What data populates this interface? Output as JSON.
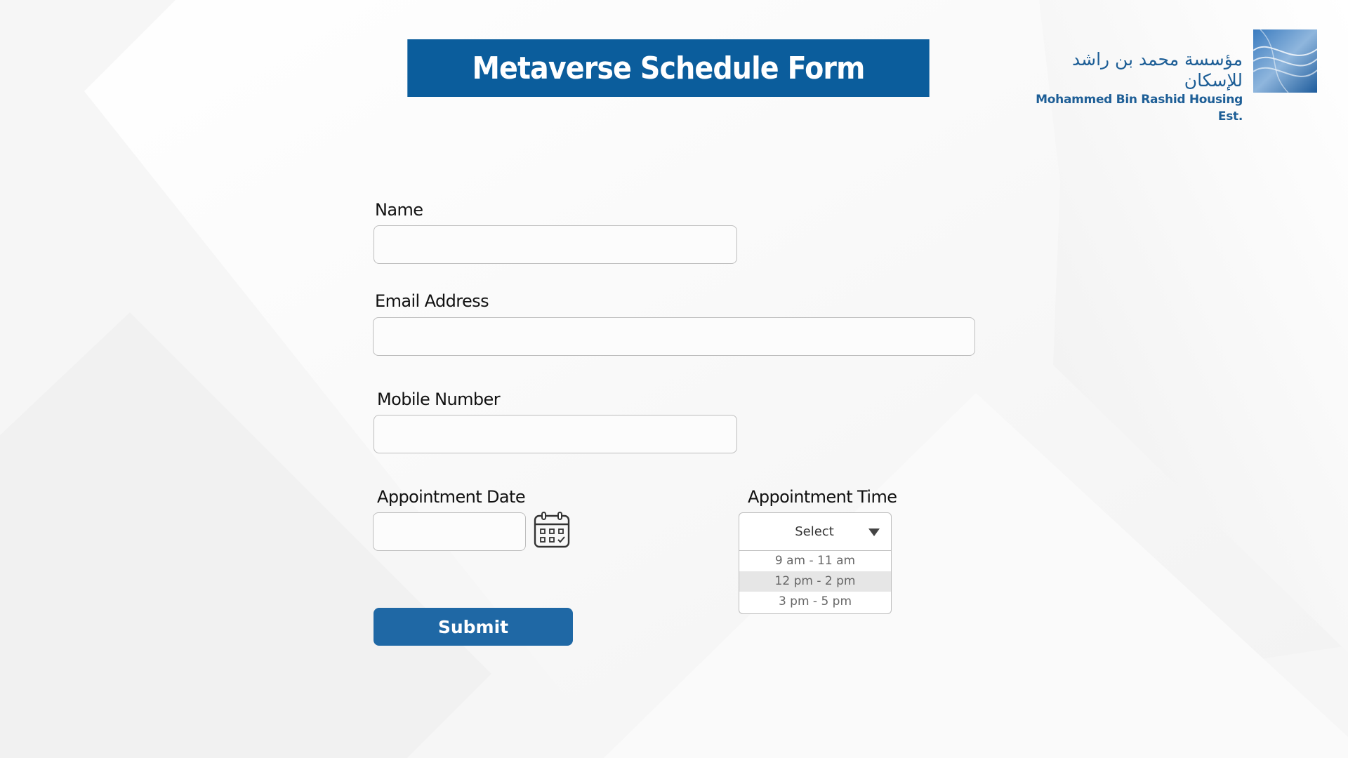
{
  "header": {
    "title": "Metaverse Schedule Form"
  },
  "logo": {
    "arabic_name": "مؤسسة محمد بن راشد للإسكان",
    "english_name": "Mohammed Bin Rashid Housing Est."
  },
  "form": {
    "name_label": "Name",
    "name_value": "",
    "email_label": "Email Address",
    "email_value": "",
    "mobile_label": "Mobile Number",
    "mobile_value": "",
    "date_label": "Appointment Date",
    "date_value": "",
    "time_label": "Appointment Time",
    "time_select": {
      "selected": "Select",
      "options": [
        "9 am - 11 am",
        "12 pm - 2 pm",
        "3 pm - 5 pm"
      ],
      "highlighted_option": "12 pm - 2 pm"
    },
    "submit_label": "Submit"
  },
  "colors": {
    "brand_blue": "#0b5d9c",
    "button_blue": "#1f68a5",
    "highlight_gray": "#e6e6e6"
  },
  "icons": {
    "calendar": "calendar-icon",
    "dropdown": "caret-down-icon"
  }
}
